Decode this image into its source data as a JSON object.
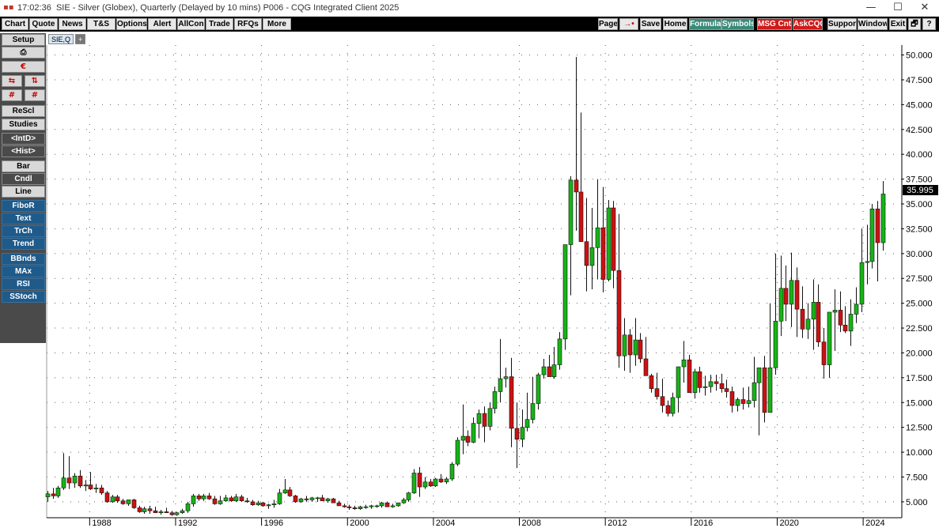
{
  "titlebar": {
    "time": "17:02:36",
    "title": "SIE - Silver (Globex), Quarterly (Delayed by 10 mins)  P006 - CQG Integrated Client 2025",
    "minimize": "—",
    "maximize": "☐",
    "close": "✕"
  },
  "menubar": {
    "left": [
      "Chart",
      "Quote",
      "News",
      "T&S",
      "Options",
      "Alert",
      "AllCon",
      "Trade",
      "RFQs",
      "More"
    ],
    "right": [
      {
        "label": "Page",
        "style": "plain"
      },
      {
        "label": "→•",
        "style": "rb"
      },
      {
        "label": "Save",
        "style": "plain"
      },
      {
        "label": "Home",
        "style": "plain"
      },
      {
        "label": "Formula",
        "style": "green"
      },
      {
        "label": "Symbols",
        "style": "green"
      },
      {
        "label": "MSG Cntr",
        "style": "red"
      },
      {
        "label": "AskCQG",
        "style": "red"
      },
      {
        "label": "Support",
        "style": "plain"
      },
      {
        "label": "Window",
        "style": "plain"
      },
      {
        "label": "Exit",
        "style": "plain"
      },
      {
        "label": "🗗",
        "style": "plain"
      },
      {
        "label": "?",
        "style": "plain"
      }
    ]
  },
  "sidebar": {
    "setup": "Setup",
    "print_icon": "⎙",
    "cqg_icon": "€",
    "row1": [
      "⇆",
      "⇅"
    ],
    "row2": [
      "#",
      "#"
    ],
    "items": [
      "ReScl",
      "Studies",
      "<IntD>",
      "<Hist>",
      "Bar",
      "Cndl",
      "Line"
    ],
    "studies": [
      "FiboR",
      "Text",
      "TrCh",
      "Trend",
      "BBnds",
      "MAx",
      "RSI",
      "SStoch"
    ]
  },
  "tabs": {
    "active": "SIE,Q",
    "add": "+"
  },
  "colors": {
    "up": "#16b316",
    "down": "#cc1111",
    "wick": "#111111",
    "grid": "#606060"
  },
  "chart_data": {
    "type": "candlestick",
    "symbol": "SIE,Q",
    "interval": "Quarterly",
    "last_price": "35.995",
    "ylim": [
      3.4,
      51.0
    ],
    "yticks": [
      "5.000",
      "7.500",
      "10.000",
      "12.500",
      "15.000",
      "17.500",
      "20.000",
      "22.500",
      "25.000",
      "27.500",
      "30.000",
      "32.500",
      "35.000",
      "37.500",
      "40.000",
      "42.500",
      "45.000",
      "47.500",
      "50.000"
    ],
    "xlim": [
      1986.0,
      2025.8
    ],
    "xticks": [
      "1988",
      "1992",
      "1996",
      "2000",
      "2004",
      "2008",
      "2012",
      "2016",
      "2020",
      "2024"
    ],
    "candles_ohlc": [
      [
        5.5,
        6.1,
        5.0,
        5.8
      ],
      [
        5.8,
        6.4,
        5.3,
        5.6
      ],
      [
        5.6,
        6.6,
        5.4,
        6.4
      ],
      [
        6.4,
        9.9,
        6.2,
        7.4
      ],
      [
        7.4,
        9.6,
        6.3,
        6.9
      ],
      [
        6.9,
        7.9,
        6.4,
        7.6
      ],
      [
        7.6,
        8.2,
        6.4,
        6.6
      ],
      [
        6.6,
        7.2,
        6.1,
        6.7
      ],
      [
        6.7,
        8.0,
        6.2,
        6.3
      ],
      [
        6.3,
        6.8,
        5.9,
        6.4
      ],
      [
        6.4,
        6.7,
        5.7,
        5.9
      ],
      [
        5.9,
        6.1,
        4.9,
        5.0
      ],
      [
        5.0,
        5.7,
        4.9,
        5.5
      ],
      [
        5.5,
        5.7,
        4.9,
        5.1
      ],
      [
        5.1,
        5.3,
        4.7,
        4.8
      ],
      [
        4.8,
        5.2,
        4.6,
        5.2
      ],
      [
        5.2,
        5.3,
        4.3,
        4.4
      ],
      [
        4.4,
        4.6,
        3.9,
        4.0
      ],
      [
        4.0,
        4.5,
        3.8,
        4.3
      ],
      [
        4.3,
        4.6,
        3.8,
        4.1
      ],
      [
        4.1,
        4.5,
        3.9,
        3.9
      ],
      [
        3.9,
        4.2,
        3.7,
        4.0
      ],
      [
        4.0,
        4.4,
        3.9,
        3.9
      ],
      [
        3.9,
        4.1,
        3.6,
        3.7
      ],
      [
        3.7,
        4.0,
        3.6,
        3.9
      ],
      [
        3.9,
        4.3,
        3.8,
        4.1
      ],
      [
        4.1,
        5.0,
        3.9,
        4.8
      ],
      [
        4.8,
        5.8,
        4.5,
        5.6
      ],
      [
        5.6,
        5.8,
        5.1,
        5.3
      ],
      [
        5.3,
        5.8,
        5.1,
        5.6
      ],
      [
        5.6,
        5.9,
        5.2,
        5.3
      ],
      [
        5.3,
        5.6,
        4.7,
        4.8
      ],
      [
        4.8,
        5.6,
        4.7,
        5.1
      ],
      [
        5.1,
        5.7,
        5.0,
        5.4
      ],
      [
        5.4,
        5.6,
        5.0,
        5.1
      ],
      [
        5.1,
        5.8,
        5.0,
        5.5
      ],
      [
        5.5,
        5.7,
        5.0,
        5.1
      ],
      [
        5.1,
        5.4,
        4.9,
        5.0
      ],
      [
        5.0,
        5.2,
        4.6,
        4.7
      ],
      [
        4.7,
        5.1,
        4.6,
        4.9
      ],
      [
        4.9,
        5.0,
        4.5,
        4.6
      ],
      [
        4.6,
        4.8,
        4.3,
        4.7
      ],
      [
        4.7,
        5.2,
        4.4,
        4.8
      ],
      [
        4.8,
        6.3,
        4.7,
        5.9
      ],
      [
        5.9,
        7.3,
        5.8,
        6.2
      ],
      [
        6.2,
        6.5,
        5.5,
        5.6
      ],
      [
        5.6,
        5.7,
        4.9,
        5.0
      ],
      [
        5.0,
        5.4,
        4.9,
        5.3
      ],
      [
        5.3,
        5.6,
        5.0,
        5.2
      ],
      [
        5.2,
        5.5,
        5.0,
        5.4
      ],
      [
        5.4,
        5.5,
        5.0,
        5.4
      ],
      [
        5.4,
        5.7,
        5.1,
        5.1
      ],
      [
        5.1,
        5.4,
        4.9,
        5.3
      ],
      [
        5.3,
        5.4,
        4.9,
        4.9
      ],
      [
        4.9,
        5.1,
        4.6,
        4.6
      ],
      [
        4.6,
        4.8,
        4.4,
        4.5
      ],
      [
        4.5,
        4.7,
        4.2,
        4.4
      ],
      [
        4.4,
        4.6,
        4.2,
        4.3
      ],
      [
        4.3,
        4.6,
        4.2,
        4.5
      ],
      [
        4.5,
        4.7,
        4.3,
        4.5
      ],
      [
        4.5,
        4.7,
        4.3,
        4.6
      ],
      [
        4.6,
        4.7,
        4.4,
        4.6
      ],
      [
        4.6,
        5.0,
        4.4,
        4.9
      ],
      [
        4.9,
        5.0,
        4.5,
        4.5
      ],
      [
        4.5,
        4.8,
        4.4,
        4.6
      ],
      [
        4.6,
        4.9,
        4.5,
        4.9
      ],
      [
        4.9,
        5.4,
        4.8,
        5.2
      ],
      [
        5.2,
        6.0,
        5.0,
        5.9
      ],
      [
        5.9,
        8.3,
        5.8,
        7.9
      ],
      [
        7.9,
        8.5,
        5.5,
        6.5
      ],
      [
        6.5,
        7.5,
        6.3,
        7.0
      ],
      [
        7.0,
        7.3,
        6.5,
        6.6
      ],
      [
        6.6,
        7.4,
        6.5,
        7.3
      ],
      [
        7.3,
        7.8,
        6.9,
        7.0
      ],
      [
        7.0,
        7.5,
        6.8,
        7.3
      ],
      [
        7.3,
        9.0,
        7.1,
        8.8
      ],
      [
        8.8,
        11.5,
        8.6,
        11.2
      ],
      [
        11.2,
        14.8,
        9.8,
        11.6
      ],
      [
        11.6,
        12.2,
        10.6,
        11.0
      ],
      [
        11.0,
        13.5,
        10.9,
        12.9
      ],
      [
        12.9,
        14.3,
        11.4,
        13.9
      ],
      [
        13.9,
        14.6,
        11.0,
        12.6
      ],
      [
        12.6,
        15.0,
        12.2,
        14.4
      ],
      [
        14.4,
        16.6,
        13.9,
        16.1
      ],
      [
        16.1,
        21.4,
        15.0,
        17.4
      ],
      [
        17.4,
        18.5,
        16.5,
        17.6
      ],
      [
        17.6,
        19.5,
        10.5,
        12.4
      ],
      [
        12.4,
        15.0,
        8.4,
        11.3
      ],
      [
        11.3,
        14.3,
        10.5,
        12.5
      ],
      [
        12.5,
        16.0,
        12.1,
        13.3
      ],
      [
        13.3,
        17.6,
        12.9,
        14.9
      ],
      [
        14.9,
        18.0,
        14.3,
        17.8
      ],
      [
        17.8,
        19.4,
        17.4,
        18.6
      ],
      [
        18.6,
        19.8,
        17.7,
        17.6
      ],
      [
        17.6,
        20.6,
        17.4,
        18.8
      ],
      [
        18.8,
        22.1,
        18.3,
        21.4
      ],
      [
        21.4,
        29.4,
        20.3,
        30.9
      ],
      [
        30.9,
        37.8,
        25.8,
        37.4
      ],
      [
        37.4,
        49.8,
        32.3,
        36.2
      ],
      [
        36.2,
        44.2,
        32.0,
        31.2
      ],
      [
        31.2,
        35.6,
        26.2,
        28.8
      ],
      [
        28.8,
        34.6,
        26.4,
        30.6
      ],
      [
        30.6,
        37.5,
        27.4,
        32.6
      ],
      [
        32.6,
        36.7,
        26.1,
        27.4
      ],
      [
        27.4,
        35.4,
        27.2,
        34.6
      ],
      [
        34.6,
        35.3,
        26.5,
        28.3
      ],
      [
        28.3,
        34.0,
        18.5,
        19.7
      ],
      [
        19.7,
        23.5,
        18.2,
        21.8
      ],
      [
        21.8,
        22.4,
        18.0,
        19.8
      ],
      [
        19.8,
        23.5,
        18.7,
        21.3
      ],
      [
        21.3,
        22.0,
        19.0,
        19.4
      ],
      [
        19.4,
        21.6,
        18.1,
        17.7
      ],
      [
        17.7,
        17.9,
        16.0,
        16.4
      ],
      [
        16.4,
        18.0,
        15.3,
        15.6
      ],
      [
        15.6,
        17.4,
        14.0,
        14.7
      ],
      [
        14.7,
        15.2,
        13.6,
        13.9
      ],
      [
        13.9,
        16.0,
        13.6,
        15.5
      ],
      [
        15.5,
        18.4,
        14.0,
        18.6
      ],
      [
        18.6,
        21.2,
        17.0,
        19.3
      ],
      [
        19.3,
        19.8,
        16.1,
        16.0
      ],
      [
        16.0,
        18.4,
        15.4,
        18.1
      ],
      [
        18.1,
        18.6,
        16.0,
        16.5
      ],
      [
        16.5,
        17.7,
        15.7,
        16.6
      ],
      [
        16.6,
        17.8,
        16.0,
        17.1
      ],
      [
        17.1,
        17.8,
        16.2,
        16.9
      ],
      [
        16.9,
        17.9,
        16.0,
        16.4
      ],
      [
        16.4,
        17.3,
        15.5,
        16.1
      ],
      [
        16.1,
        16.6,
        14.0,
        14.7
      ],
      [
        14.7,
        15.5,
        14.1,
        15.3
      ],
      [
        15.3,
        16.5,
        14.3,
        14.9
      ],
      [
        14.9,
        16.6,
        14.5,
        15.2
      ],
      [
        15.2,
        19.6,
        14.5,
        17.0
      ],
      [
        17.0,
        18.3,
        11.7,
        18.5
      ],
      [
        18.5,
        19.7,
        13.0,
        14.0
      ],
      [
        14.0,
        25.0,
        17.3,
        18.5
      ],
      [
        18.5,
        30.0,
        17.8,
        23.2
      ],
      [
        23.2,
        29.8,
        21.7,
        26.5
      ],
      [
        26.5,
        28.8,
        23.2,
        24.9
      ],
      [
        24.9,
        30.1,
        22.6,
        27.3
      ],
      [
        27.3,
        28.6,
        21.6,
        24.4
      ],
      [
        24.4,
        26.7,
        21.5,
        22.4
      ],
      [
        22.4,
        25.0,
        21.4,
        23.4
      ],
      [
        23.4,
        27.4,
        20.3,
        25.1
      ],
      [
        25.1,
        26.9,
        20.6,
        21.1
      ],
      [
        21.1,
        22.5,
        17.4,
        18.8
      ],
      [
        18.8,
        23.5,
        17.5,
        24.1
      ],
      [
        24.1,
        26.4,
        20.2,
        24.3
      ],
      [
        24.3,
        26.2,
        22.1,
        22.8
      ],
      [
        22.8,
        24.7,
        22.0,
        22.2
      ],
      [
        22.2,
        25.4,
        20.7,
        23.9
      ],
      [
        23.9,
        26.6,
        23.0,
        24.9
      ],
      [
        24.9,
        32.5,
        24.1,
        29.1
      ],
      [
        29.1,
        32.9,
        26.9,
        29.2
      ],
      [
        29.2,
        35.0,
        28.5,
        34.5
      ],
      [
        34.5,
        35.3,
        27.2,
        31.1
      ],
      [
        31.1,
        37.3,
        30.3,
        36.0
      ]
    ]
  }
}
